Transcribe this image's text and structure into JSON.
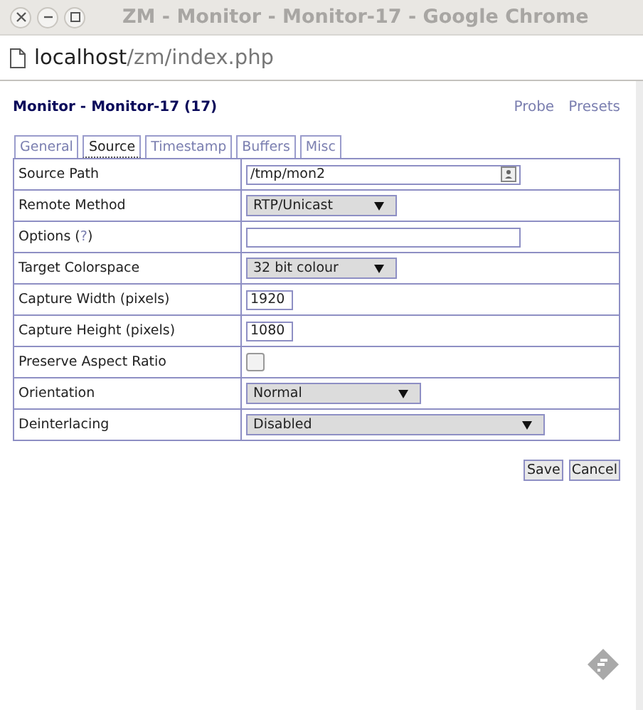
{
  "window": {
    "title": "ZM - Monitor - Monitor-17 - Google Chrome"
  },
  "address": {
    "host": "localhost",
    "path": "/zm/index.php"
  },
  "page": {
    "title": "Monitor - Monitor-17 (17)",
    "links": [
      "Probe",
      "Presets"
    ]
  },
  "tabs": [
    {
      "label": "General",
      "selected": false
    },
    {
      "label": "Source",
      "selected": true
    },
    {
      "label": "Timestamp",
      "selected": false
    },
    {
      "label": "Buffers",
      "selected": false
    },
    {
      "label": "Misc",
      "selected": false
    }
  ],
  "rows": [
    {
      "label": "Source Path",
      "kind": "path",
      "value": "/tmp/mon2"
    },
    {
      "label": "Remote Method",
      "kind": "select",
      "value": "RTP/Unicast"
    },
    {
      "label": "Options (",
      "help": "?",
      "label_end": ")",
      "kind": "text",
      "value": ""
    },
    {
      "label": "Target Colorspace",
      "kind": "select",
      "value": "32 bit colour"
    },
    {
      "label": "Capture Width (pixels)",
      "kind": "text",
      "value": "1920"
    },
    {
      "label": "Capture Height (pixels)",
      "kind": "text",
      "value": "1080"
    },
    {
      "label": "Preserve Aspect Ratio",
      "kind": "checkbox",
      "checked": false
    },
    {
      "label": "Orientation",
      "kind": "select",
      "value": "Normal"
    },
    {
      "label": "Deinterlacing",
      "kind": "select",
      "value": "Disabled"
    }
  ],
  "buttons": [
    "Save",
    "Cancel"
  ]
}
